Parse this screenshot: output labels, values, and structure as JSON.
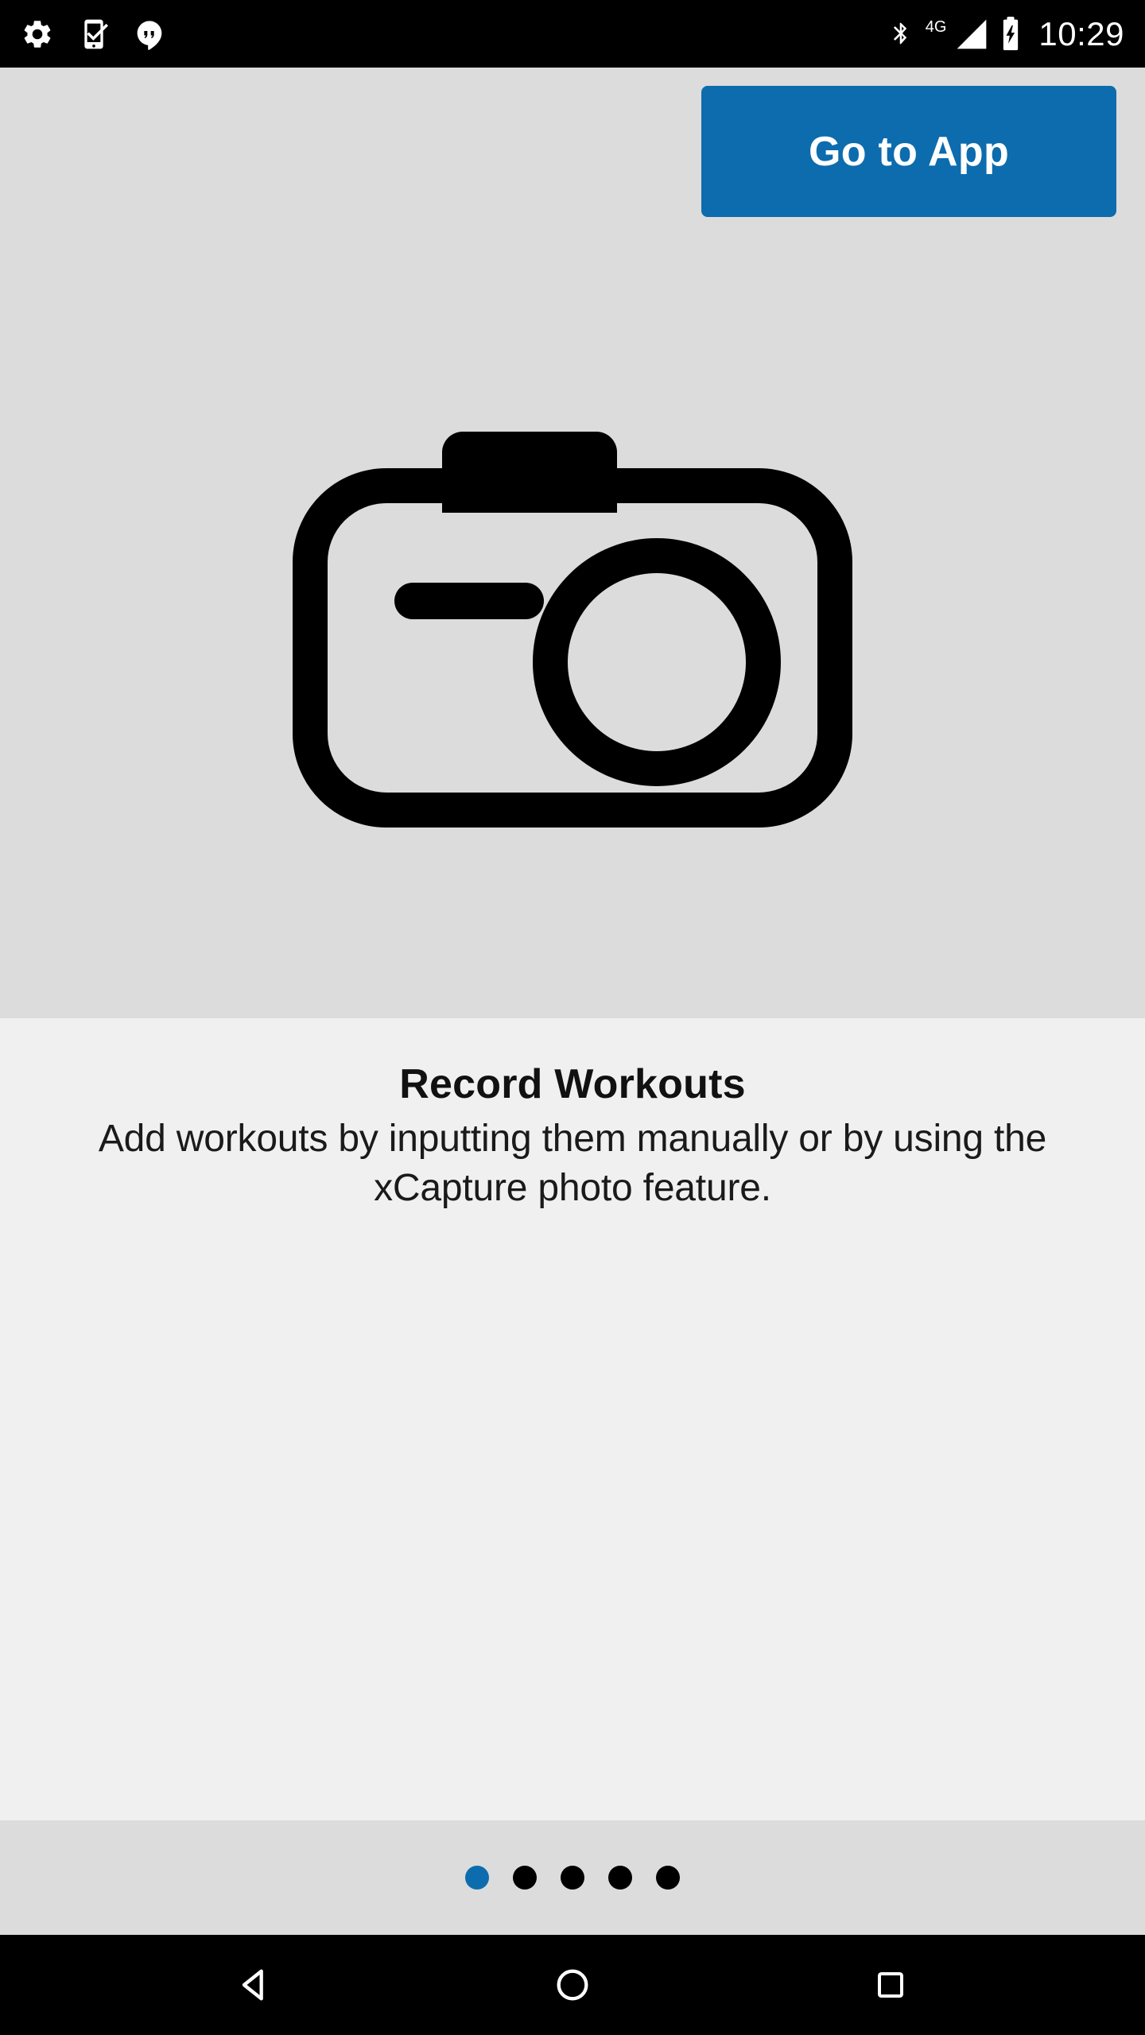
{
  "status_bar": {
    "notification_icons": [
      "settings-gear-icon",
      "phone-checkmark-icon",
      "hangouts-icon"
    ],
    "bluetooth_icon": "bluetooth-icon",
    "network_type": "4G",
    "signal_icon": "signal-bars-icon",
    "battery_icon": "battery-charging-icon",
    "time": "10:29"
  },
  "hero": {
    "background_color": "#dcdcdc",
    "go_to_app_label": "Go to App",
    "accent_color": "#0d6cad",
    "illustration": "camera-icon"
  },
  "content": {
    "background_color": "#f0f0f0",
    "headline": "Record Workouts",
    "subtext": "Add workouts by inputting them manually or by using the xCapture photo feature."
  },
  "pager": {
    "total": 5,
    "active_index": 0,
    "active_color": "#0d6cad",
    "inactive_color": "#000000"
  },
  "nav_bar": {
    "back_label": "back-button",
    "home_label": "home-button",
    "recents_label": "recents-button"
  }
}
